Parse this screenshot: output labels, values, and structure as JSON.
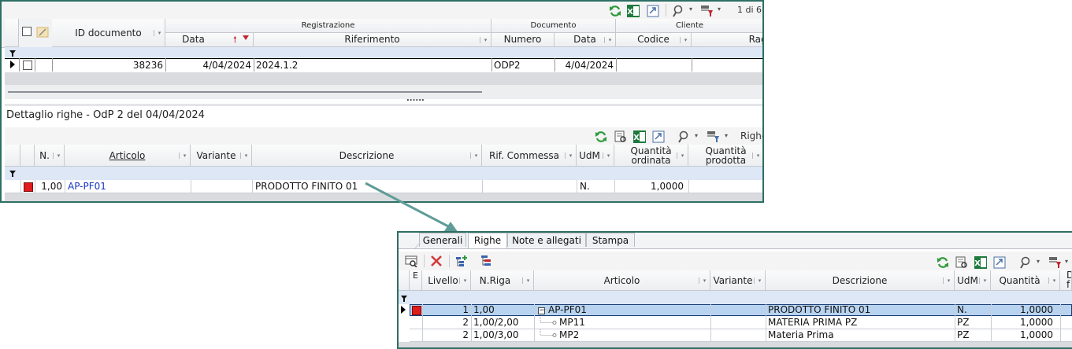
{
  "top_toolbar": {
    "page_indicator": "1 di 6"
  },
  "doc_grid": {
    "group_headers": {
      "registrazione": "Registrazione",
      "documento": "Documento",
      "cliente": "Cliente"
    },
    "columns": {
      "id_documento": "ID documento",
      "data": "Data",
      "riferimento": "Riferimento",
      "numero": "Numero",
      "data_doc": "Data",
      "codice": "Codice",
      "ragione": "Ragi"
    },
    "row": {
      "id": "38236",
      "data": "4/04/2024",
      "riferimento": "2024.1.2",
      "numero": "ODP2",
      "data_doc": "4/04/2024",
      "codice": "",
      "ragione": ""
    },
    "splitter": "......"
  },
  "detail": {
    "title": "Dettaglio righe - OdP 2 del 04/04/2024",
    "toolbar_label": "Righe",
    "columns": {
      "n": "N.",
      "articolo": "Articolo",
      "variante": "Variante",
      "descrizione": "Descrizione",
      "rif_commessa": "Rif. Commessa",
      "udm": "UdM",
      "qta_ordinata_1": "Quantità",
      "qta_ordinata_2": "ordinata",
      "qta_prodotta_1": "Quantità",
      "qta_prodotta_2": "prodotta"
    },
    "row": {
      "n": "1,00",
      "articolo": "AP-PF01",
      "variante": "",
      "descrizione": "PRODOTTO FINITO 01",
      "rif_commessa": "",
      "udm": "N.",
      "qta_ordinata": "1,0000",
      "qta_prodotta": ""
    }
  },
  "bottom_panel": {
    "tabs": [
      "Generali",
      "Righe",
      "Note e allegati",
      "Stampa"
    ],
    "active_tab": "Righe",
    "columns": {
      "e": "E",
      "livello": "Livello",
      "n_riga": "N.Riga",
      "articolo": "Articolo",
      "variante": "Variante",
      "descrizione": "Descrizione",
      "udm": "UdM",
      "quantita": "Quantità",
      "extra_1": "D",
      "extra_2": "f"
    },
    "rows": [
      {
        "livello": "1",
        "n_riga": "1,00",
        "articolo": "AP-PF01",
        "variante": "",
        "descrizione": "PRODOTTO FINITO 01",
        "udm": "N.",
        "quantita": "1,0000"
      },
      {
        "livello": "2",
        "n_riga": "1,00/2,00",
        "articolo": "MP11",
        "variante": "",
        "descrizione": "MATERIA PRIMA PZ",
        "udm": "PZ",
        "quantita": "1,0000"
      },
      {
        "livello": "2",
        "n_riga": "1,00/3,00",
        "articolo": "MP2",
        "variante": "",
        "descrizione": "Materia Prima",
        "udm": "PZ",
        "quantita": "1,0000"
      }
    ]
  },
  "colors": {
    "panel_border": "#2e6f64",
    "arrow": "#5f9c98",
    "filter_row": "#dde7f5",
    "selected_row": "#b7d3ef",
    "link_text": "#1a35c8",
    "status_red": "#e01b1b"
  },
  "icons": [
    "refresh-icon",
    "excel-icon",
    "export-icon",
    "search-icon",
    "filter-settings-icon",
    "print-preview-icon",
    "delete-icon",
    "tree-add-icon",
    "tree-icon",
    "funnel-icon",
    "checkbox-icon",
    "row-pointer-icon",
    "expand-icon"
  ]
}
